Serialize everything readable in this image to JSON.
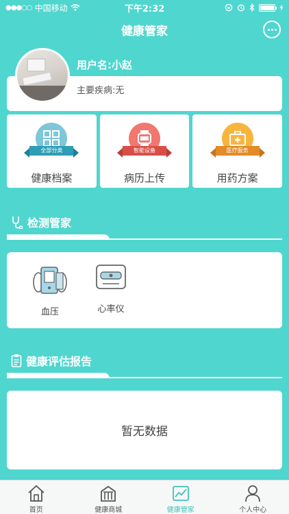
{
  "status": {
    "carrier": "中国移动",
    "time": "下午2:32"
  },
  "nav": {
    "title": "健康管家",
    "chat_icon": "chat-bubble-icon"
  },
  "profile": {
    "username": "用户名:小赵",
    "disease": "主要疾病:无"
  },
  "features": [
    {
      "label": "健康档案",
      "badge": "全部分类",
      "icon": "grid-icon",
      "color": "#7ec6d8"
    },
    {
      "label": "病历上传",
      "badge": "智能设备",
      "icon": "smartwatch-icon",
      "color": "#f2776f"
    },
    {
      "label": "用药方案",
      "badge": "医疗服务",
      "icon": "medkit-icon",
      "color": "#f8b53e"
    }
  ],
  "sections": {
    "monitor_title": "检测管家",
    "report_title": "健康评估报告"
  },
  "devices": [
    {
      "label": "血压",
      "icon": "blood-pressure-monitor-icon"
    },
    {
      "label": "心率仪",
      "icon": "heart-rate-monitor-icon"
    }
  ],
  "report": {
    "empty_text": "暂无数据"
  },
  "tabbar": [
    {
      "label": "首页",
      "icon": "home-icon",
      "active": false
    },
    {
      "label": "健康商城",
      "icon": "mall-icon",
      "active": false
    },
    {
      "label": "健康管家",
      "icon": "health-chart-icon",
      "active": true
    },
    {
      "label": "个人中心",
      "icon": "user-icon",
      "active": false
    }
  ],
  "colors": {
    "background": "#4fd6cf",
    "tab_active": "#3ec3bb"
  }
}
